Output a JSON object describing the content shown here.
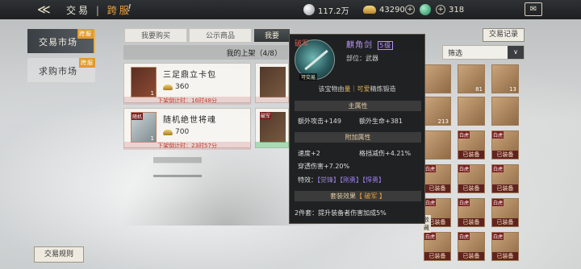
{
  "topbar": {
    "back_symbol": "≪",
    "title": "交易",
    "separator": "|",
    "mode": "跨服",
    "info_symbol": "!",
    "resources": [
      {
        "icon": "silver-coin-icon",
        "value": "117.2万"
      },
      {
        "icon": "gold-ingot-icon",
        "value": "43290"
      },
      {
        "icon": "jade-icon",
        "value": "318"
      }
    ],
    "plus_symbol": "+"
  },
  "sidebar": {
    "items": [
      {
        "label": "交易市场",
        "badge": "跨服",
        "active": true
      },
      {
        "label": "求购市场",
        "badge": "跨服",
        "active": false
      }
    ],
    "rules_button": "交易规则"
  },
  "tabs": {
    "items": [
      {
        "label": "我要购买",
        "active": false
      },
      {
        "label": "公示商品",
        "active": false
      },
      {
        "label": "我要",
        "active": true
      }
    ],
    "records_button": "交易记录"
  },
  "shelf": {
    "header": "我的上架（4/8）",
    "filter_label": "筛选",
    "filter_arrow": "∨",
    "listings": [
      {
        "name": "三足鼎立卡包",
        "price": "360",
        "qty": "1",
        "tag": "",
        "timer": "下架倒计时：16时48分"
      },
      {
        "name": "随机绝世将魂",
        "price": "700",
        "qty": "1",
        "tag": "随机",
        "timer": "下架倒计时：23时57分"
      }
    ],
    "partial": [
      {
        "tag": "",
        "qty": "1"
      },
      {
        "tag": "破军",
        "qty": "1"
      }
    ]
  },
  "inventory": {
    "cells": [
      {
        "tag": "",
        "num": "",
        "equip": ""
      },
      {
        "tag": "",
        "num": "81",
        "equip": ""
      },
      {
        "tag": "",
        "num": "13",
        "equip": ""
      },
      {
        "tag": "",
        "num": "213",
        "equip": ""
      },
      {
        "tag": "",
        "num": "",
        "equip": ""
      },
      {
        "tag": "",
        "num": "",
        "equip": ""
      },
      {
        "tag": "",
        "num": "",
        "equip": ""
      },
      {
        "tag": "白虎",
        "num": "",
        "equip": "已装备"
      },
      {
        "tag": "白虎",
        "num": "",
        "equip": "已装备"
      },
      {
        "tag": "白虎",
        "num": "",
        "equip": "已装备"
      },
      {
        "tag": "白虎",
        "num": "",
        "equip": "已装备"
      },
      {
        "tag": "白虎",
        "num": "",
        "equip": "已装备"
      },
      {
        "tag": "白虎",
        "num": "",
        "equip": "已装备"
      },
      {
        "tag": "白虎",
        "num": "",
        "equip": "已装备"
      },
      {
        "tag": "白虎",
        "num": "",
        "equip": "已装备"
      },
      {
        "tag": "白虎",
        "num": "",
        "equip": "已装备"
      },
      {
        "tag": "白虎",
        "num": "",
        "equip": "已装备"
      },
      {
        "tag": "白虎",
        "num": "",
        "equip": "已装备"
      },
      {
        "tag": "白虎",
        "num": "",
        "equip": "已装备"
      }
    ],
    "equipped_label": "已装备",
    "collect_badge": "收藏"
  },
  "tooltip": {
    "set_tag": "破军",
    "item_name": "麒角剑",
    "grade": "5级",
    "slot": "部位：武器",
    "tradable": "可交易",
    "forge_prefix": "该宝物由",
    "forge_highlight": "量｜可爱",
    "forge_suffix": "精炼锻造",
    "main_attr_title": "主属性",
    "main_attrs": [
      "额外攻击+149",
      "额外生命+381"
    ],
    "extra_attr_title": "附加属性",
    "extra_attrs": [
      "速度+2",
      "格挡减伤+4.21%",
      "穿透伤害+7.20%"
    ],
    "skills_label": "特效：",
    "skills": [
      "【觉锋】",
      "【刚勇】",
      "【悍勇】"
    ],
    "set_title_prefix": "套装效果",
    "set_title_name": "【 破军 】",
    "set_effect": "2件套：提升装备者伤害加成5%"
  }
}
